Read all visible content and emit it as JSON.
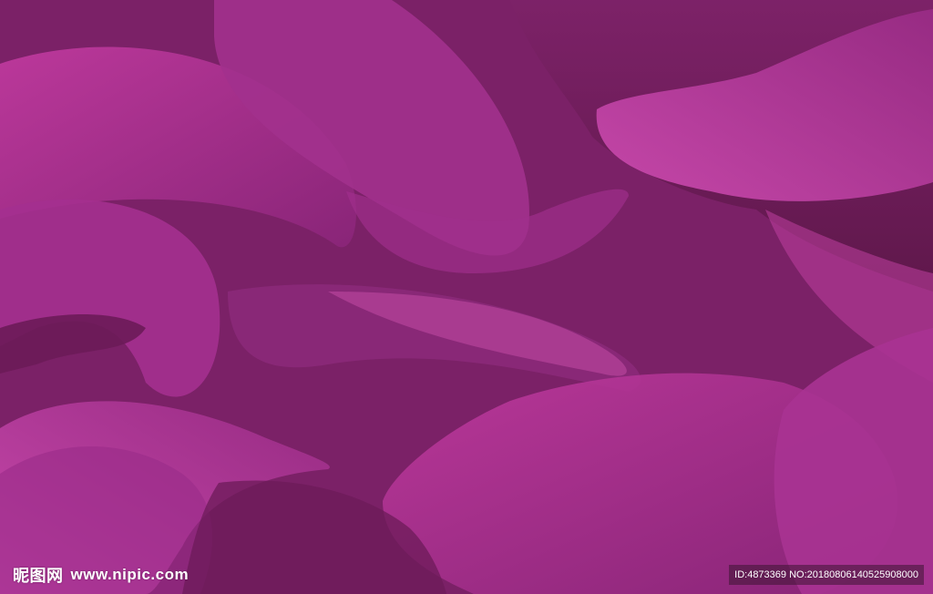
{
  "image": {
    "description_tag": "abstract magenta overlapping curved shapes background",
    "palette": {
      "base": "#7a2067",
      "light": "#c23ea0",
      "mid": "#a13090",
      "dark": "#5c1748",
      "highlight": "#d050b0"
    }
  },
  "watermark": {
    "brand": "昵图网",
    "url": "www.nipic.com",
    "id_text": "ID:4873369 NO:20180806140525908000"
  }
}
